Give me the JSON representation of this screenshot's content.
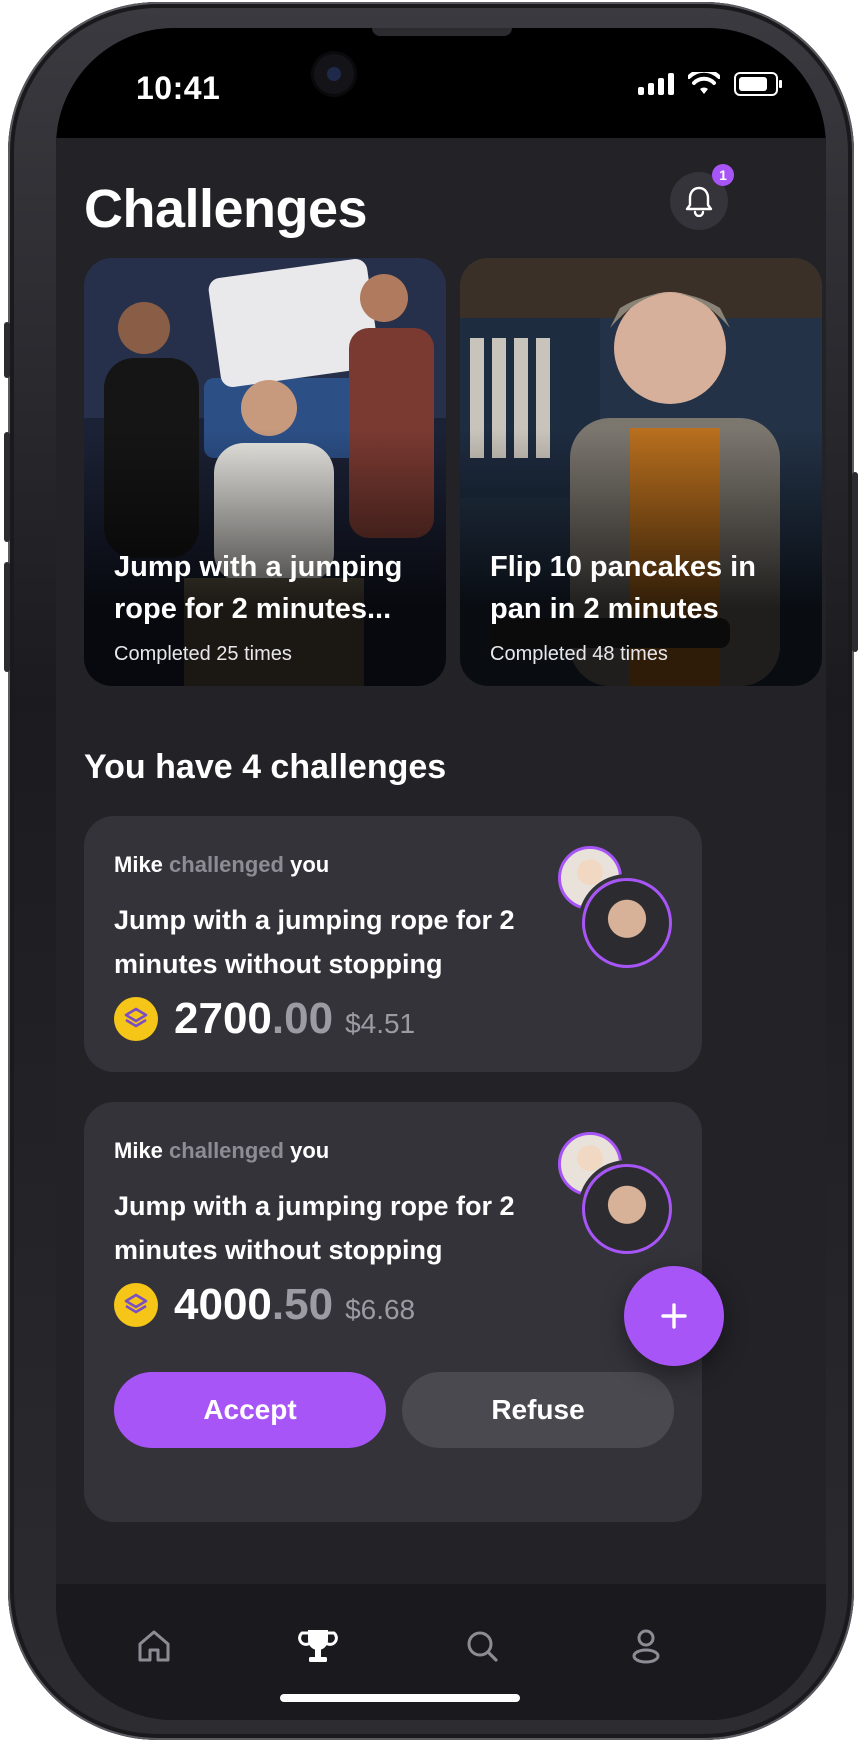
{
  "status_bar": {
    "time": "10:41"
  },
  "header": {
    "title": "Challenges",
    "notification_count": "1"
  },
  "featured": [
    {
      "title": "Jump with a jumping rope for 2 minutes...",
      "subtitle": "Completed 25 times"
    },
    {
      "title": "Flip 10 pancakes in pan in 2 minutes",
      "subtitle": "Completed 48 times"
    }
  ],
  "list": {
    "section_title": "You have 4 challenges",
    "items": [
      {
        "challenger_name": "Mike",
        "challenger_verb": "challenged",
        "challenger_target": "you",
        "text": "Jump with a jumping rope for 2 minutes without stopping",
        "amount_int": "2700",
        "amount_dec": ".00",
        "usd": "$4.51"
      },
      {
        "challenger_name": "Mike",
        "challenger_verb": "challenged",
        "challenger_target": "you",
        "text": "Jump with a jumping rope for 2 minutes without stopping",
        "amount_int": "4000",
        "amount_dec": ".50",
        "usd": "$6.68",
        "accept_label": "Accept",
        "refuse_label": "Refuse"
      }
    ]
  },
  "fab": {
    "icon": "plus-icon"
  },
  "tabbar": {
    "items": [
      {
        "icon": "home-icon",
        "active": false
      },
      {
        "icon": "trophy-icon",
        "active": true
      },
      {
        "icon": "search-icon",
        "active": false
      },
      {
        "icon": "profile-icon",
        "active": false
      }
    ]
  },
  "colors": {
    "accent": "#a855f7",
    "background": "#232227",
    "card": "#34333a",
    "coin": "#f5c518"
  }
}
